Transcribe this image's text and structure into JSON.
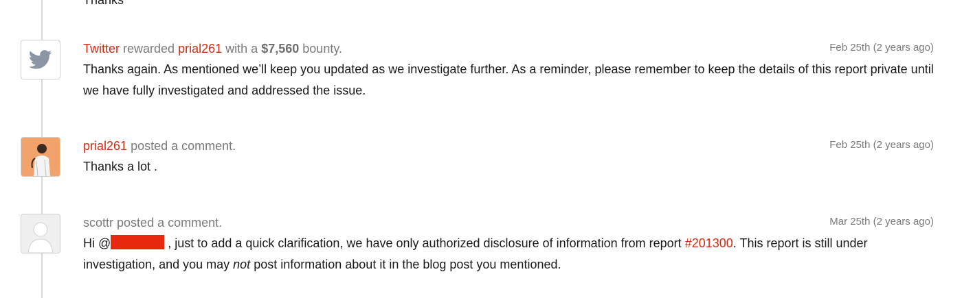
{
  "top_fragment": "Thanks",
  "entries": [
    {
      "avatar": "twitter-bird-icon",
      "actor": "Twitter",
      "verb": "rewarded",
      "target": "prial261",
      "with_text": "with a",
      "amount": "$7,560",
      "suffix": "bounty.",
      "date": "Feb 25th (2 years ago)",
      "body": "Thanks again. As mentioned we’ll keep you updated as we investigate further. As a reminder, please remember to keep the details of this report private until we have fully investigated and addressed the issue."
    },
    {
      "avatar": "user-photo",
      "actor": "prial261",
      "action": "posted a comment.",
      "date": "Feb 25th (2 years ago)",
      "body": "Thanks a lot ."
    },
    {
      "avatar": "default-user-icon",
      "actor": "scottr",
      "action": "posted a comment.",
      "date": "Mar 25th (2 years ago)",
      "body_part1": "Hi @",
      "body_part2": ", just to add a quick clarification, we have only authorized disclosure of information from report",
      "report_link": "#201300",
      "body_part3": ". This report is still under investigation, and you may",
      "emphasis": "not",
      "body_part4": "post information about it in the blog post you mentioned."
    }
  ],
  "colors": {
    "link": "#d42a10",
    "redaction": "#e8270f",
    "timeline": "#d8d8d8",
    "muted_text": "#7a7a7a"
  }
}
